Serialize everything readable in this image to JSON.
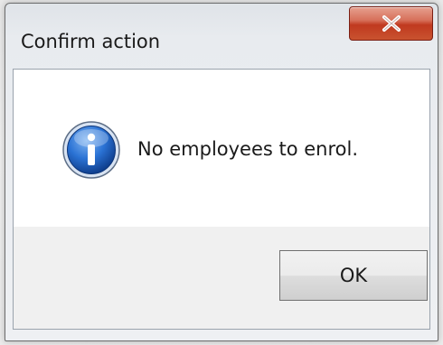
{
  "dialog": {
    "title": "Confirm action",
    "message": "No employees to enrol.",
    "ok_label": "OK",
    "close_icon": "close-icon",
    "message_icon": "information-icon"
  },
  "colors": {
    "close_button": "#c9532f",
    "info_icon_blue": "#1f63c6",
    "content_background": "#ffffff",
    "footer_background": "#f0f0f0"
  }
}
